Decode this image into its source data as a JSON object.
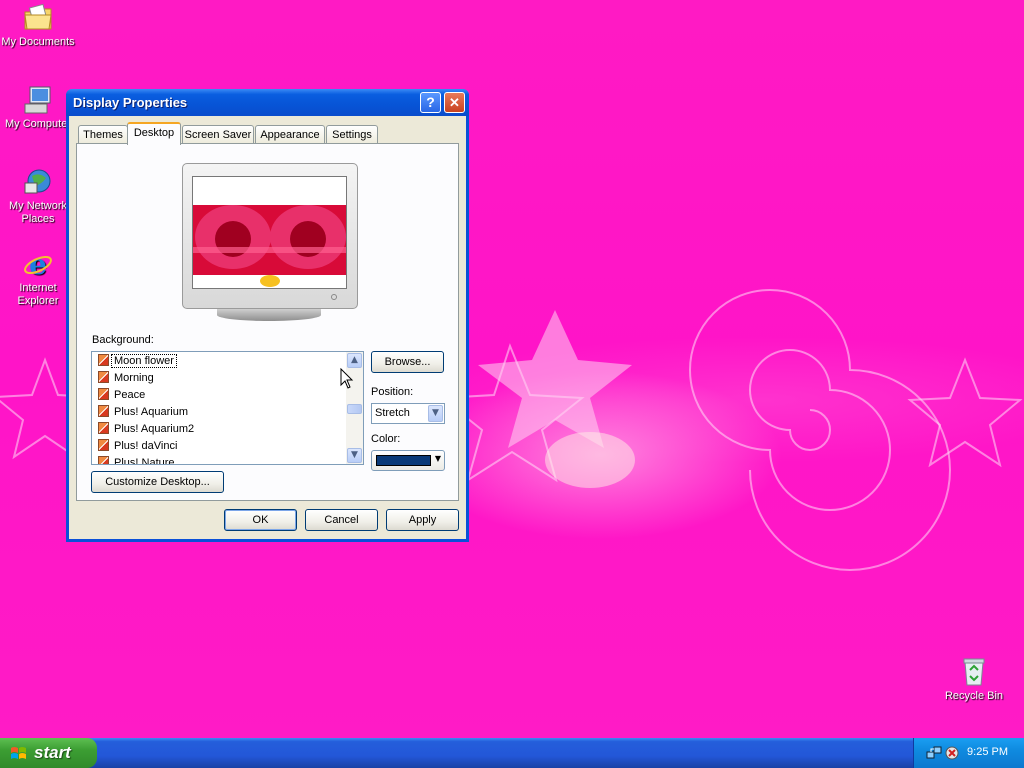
{
  "desktop": {
    "icons": [
      {
        "label": "My Documents",
        "icon": "folder-documents-icon"
      },
      {
        "label": "My Computer",
        "icon": "computer-icon"
      },
      {
        "label": "My Network Places",
        "icon": "network-places-icon"
      },
      {
        "label": "Internet Explorer",
        "icon": "internet-explorer-icon"
      },
      {
        "label": "Recycle Bin",
        "icon": "recycle-bin-icon"
      }
    ]
  },
  "dialog": {
    "title": "Display Properties",
    "help_label": "?",
    "close_label": "✕",
    "tabs": [
      "Themes",
      "Desktop",
      "Screen Saver",
      "Appearance",
      "Settings"
    ],
    "active_tab": "Desktop",
    "background_label": "Background:",
    "background_items": [
      "Moon flower",
      "Morning",
      "Peace",
      "Plus! Aquarium",
      "Plus! Aquarium2",
      "Plus! daVinci",
      "Plus! Nature"
    ],
    "selected_background": "Moon flower",
    "browse_label": "Browse...",
    "position_label": "Position:",
    "position_value": "Stretch",
    "color_label": "Color:",
    "color_value": "#0a3a78",
    "customize_label": "Customize Desktop...",
    "ok_label": "OK",
    "cancel_label": "Cancel",
    "apply_label": "Apply"
  },
  "taskbar": {
    "start_label": "start",
    "clock": "9:25 PM",
    "tray_icons": [
      "network-icon",
      "security-alert-icon"
    ]
  },
  "colors": {
    "desktop_bg": "#ff19c8",
    "titlebar": "#0754d6",
    "taskbar": "#245edb",
    "start_button": "#3c9e33",
    "dialog_bg": "#ece9d8"
  }
}
